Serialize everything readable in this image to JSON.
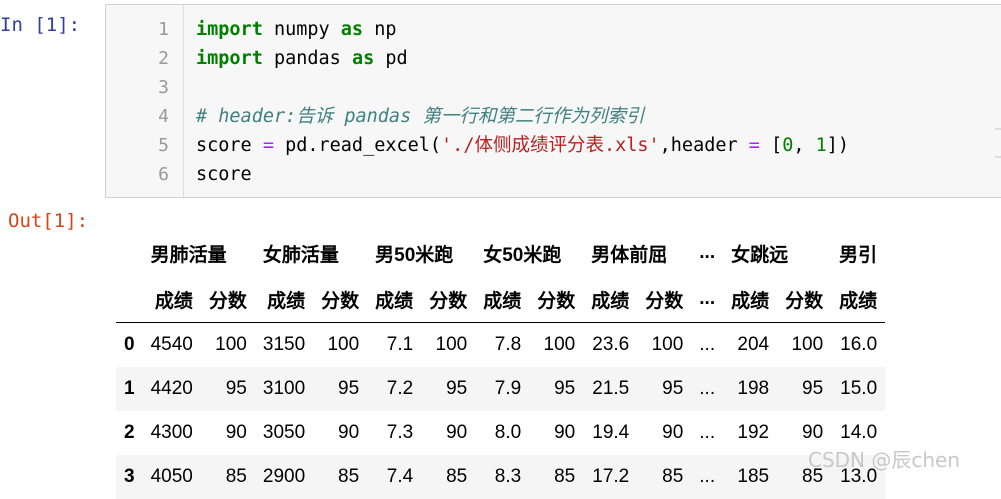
{
  "input_prompt": "In  [1]:",
  "output_prompt": "Out[1]:",
  "code_lines": [
    {
      "num": "1",
      "parts": [
        {
          "t": "import",
          "c": "kw"
        },
        {
          "t": " numpy ",
          "c": ""
        },
        {
          "t": "as",
          "c": "kw"
        },
        {
          "t": " np",
          "c": ""
        }
      ]
    },
    {
      "num": "2",
      "parts": [
        {
          "t": "import",
          "c": "kw"
        },
        {
          "t": " pandas ",
          "c": ""
        },
        {
          "t": "as",
          "c": "kw"
        },
        {
          "t": " pd",
          "c": ""
        }
      ]
    },
    {
      "num": "3",
      "parts": []
    },
    {
      "num": "4",
      "parts": [
        {
          "t": "# header:告诉 pandas 第一行和第二行作为列索引",
          "c": "cm"
        }
      ]
    },
    {
      "num": "5",
      "parts": [
        {
          "t": "score ",
          "c": ""
        },
        {
          "t": "=",
          "c": "op"
        },
        {
          "t": " pd.read_excel(",
          "c": ""
        },
        {
          "t": "'./体侧成绩评分表.xls'",
          "c": "st"
        },
        {
          "t": ",header ",
          "c": ""
        },
        {
          "t": "=",
          "c": "op"
        },
        {
          "t": " [",
          "c": ""
        },
        {
          "t": "0",
          "c": "nm"
        },
        {
          "t": ", ",
          "c": ""
        },
        {
          "t": "1",
          "c": "nm"
        },
        {
          "t": "])",
          "c": ""
        }
      ]
    },
    {
      "num": "6",
      "parts": [
        {
          "t": "score",
          "c": ""
        }
      ]
    }
  ],
  "table": {
    "top_headers": [
      {
        "label": "男肺活量",
        "span": 2
      },
      {
        "label": "女肺活量",
        "span": 2
      },
      {
        "label": "男50米跑",
        "span": 2
      },
      {
        "label": "女50米跑",
        "span": 2
      },
      {
        "label": "男体前屈",
        "span": 2
      },
      {
        "label": "...",
        "span": 1
      },
      {
        "label": "女跳远",
        "span": 2
      },
      {
        "label": "男引",
        "span": 1
      }
    ],
    "sub_headers": [
      "成绩",
      "分数",
      "成绩",
      "分数",
      "成绩",
      "分数",
      "成绩",
      "分数",
      "成绩",
      "分数",
      "...",
      "成绩",
      "分数",
      "成绩"
    ],
    "rows": [
      {
        "index": "0",
        "cells": [
          "4540",
          "100",
          "3150",
          "100",
          "7.1",
          "100",
          "7.8",
          "100",
          "23.6",
          "100",
          "...",
          "204",
          "100",
          "16.0"
        ]
      },
      {
        "index": "1",
        "cells": [
          "4420",
          "95",
          "3100",
          "95",
          "7.2",
          "95",
          "7.9",
          "95",
          "21.5",
          "95",
          "...",
          "198",
          "95",
          "15.0"
        ]
      },
      {
        "index": "2",
        "cells": [
          "4300",
          "90",
          "3050",
          "90",
          "7.3",
          "90",
          "8.0",
          "90",
          "19.4",
          "90",
          "...",
          "192",
          "90",
          "14.0"
        ]
      },
      {
        "index": "3",
        "cells": [
          "4050",
          "85",
          "2900",
          "85",
          "7.4",
          "85",
          "8.3",
          "85",
          "17.2",
          "85",
          "...",
          "185",
          "85",
          "13.0"
        ]
      }
    ]
  },
  "watermark": "CSDN @辰chen"
}
